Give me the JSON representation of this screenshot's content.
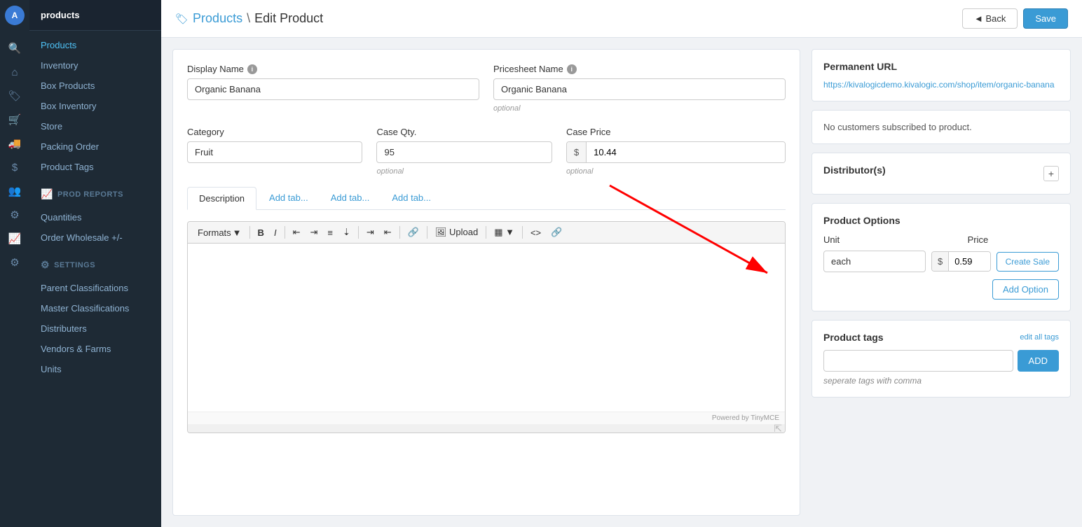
{
  "app": {
    "name": "products",
    "user_initial": "A"
  },
  "breadcrumb": {
    "link": "Products",
    "separator": "\\",
    "current": "Edit Product"
  },
  "actions": {
    "back_label": "◄ Back",
    "save_label": "Save"
  },
  "sidebar": {
    "section_nav": {
      "items": [
        {
          "id": "products",
          "label": "Products"
        },
        {
          "id": "inventory",
          "label": "Inventory"
        },
        {
          "id": "box-products",
          "label": "Box Products"
        },
        {
          "id": "box-inventory",
          "label": "Box Inventory"
        },
        {
          "id": "store",
          "label": "Store"
        },
        {
          "id": "packing-order",
          "label": "Packing Order"
        },
        {
          "id": "product-tags",
          "label": "Product Tags"
        }
      ]
    },
    "prod_reports": {
      "title": "PROD REPORTS",
      "items": [
        {
          "id": "quantities",
          "label": "Quantities"
        },
        {
          "id": "order-wholesale",
          "label": "Order Wholesale +/-"
        }
      ]
    },
    "settings": {
      "title": "SETTINGS",
      "items": [
        {
          "id": "parent-classifications",
          "label": "Parent Classifications"
        },
        {
          "id": "master-classifications",
          "label": "Master Classifications"
        },
        {
          "id": "distributers",
          "label": "Distributers"
        },
        {
          "id": "vendors-farms",
          "label": "Vendors & Farms"
        },
        {
          "id": "units",
          "label": "Units"
        }
      ]
    }
  },
  "form": {
    "display_name_label": "Display Name",
    "display_name_value": "Organic Banana",
    "pricesheet_name_label": "Pricesheet Name",
    "pricesheet_name_value": "Organic Banana",
    "pricesheet_name_hint": "optional",
    "category_label": "Category",
    "category_value": "Fruit",
    "case_qty_label": "Case Qty.",
    "case_qty_value": "95",
    "case_qty_hint": "optional",
    "case_price_label": "Case Price",
    "case_price_value": "10.44",
    "case_price_prefix": "$",
    "case_price_hint": "optional"
  },
  "tabs": {
    "active": "Description",
    "items": [
      "Description",
      "Add tab...",
      "Add tab...",
      "Add tab..."
    ]
  },
  "editor": {
    "powered_by": "Powered by TinyMCE",
    "formats_label": "Formats"
  },
  "right_panel": {
    "permanent_url": {
      "title": "Permanent URL",
      "url": "https://kivalogicdemo.kivalogic.com/shop/item/organic-banana"
    },
    "customers": {
      "message": "No customers subscribed to product."
    },
    "distributors": {
      "title": "Distributor(s)"
    },
    "product_options": {
      "title": "Product Options",
      "col_unit": "Unit",
      "col_price": "Price",
      "unit_value": "each",
      "price_prefix": "$",
      "price_value": "0.59",
      "create_sale_label": "Create Sale",
      "add_option_label": "Add Option"
    },
    "product_tags": {
      "title": "Product tags",
      "edit_all_label": "edit all tags",
      "placeholder": "",
      "add_label": "ADD",
      "hint": "seperate tags with comma"
    }
  }
}
